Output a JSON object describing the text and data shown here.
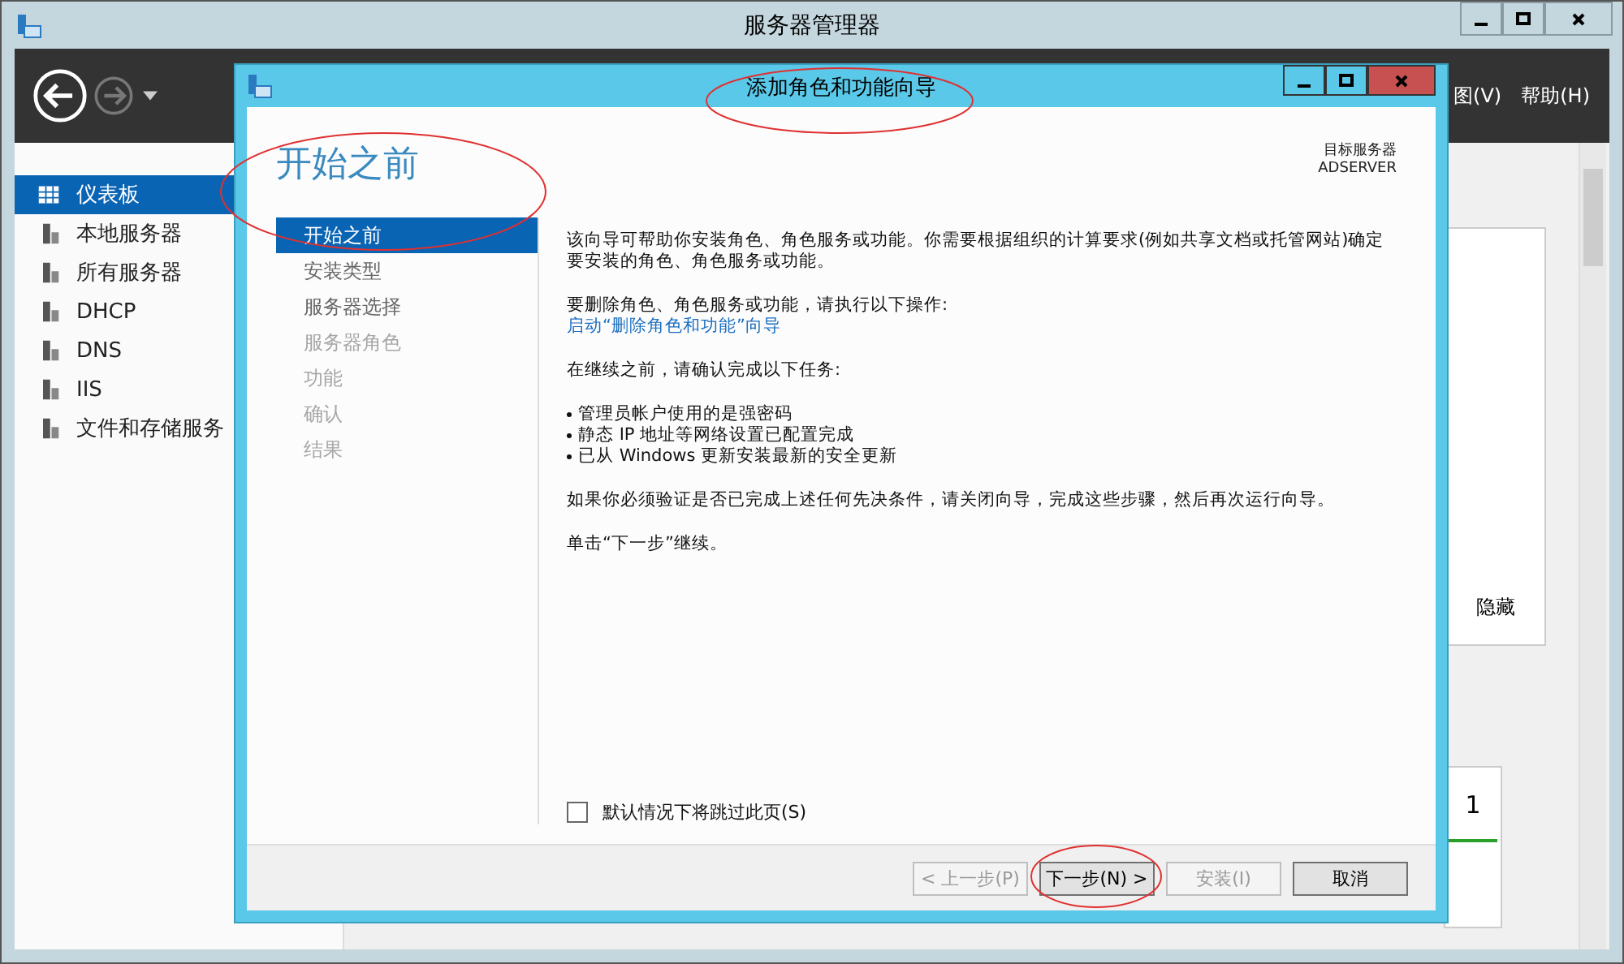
{
  "window": {
    "title": "服务器管理器"
  },
  "menu": [
    "图(V)",
    "帮助(H)"
  ],
  "sidebar": {
    "items": [
      {
        "label": "仪表板",
        "selected": true
      },
      {
        "label": "本地服务器",
        "selected": false
      },
      {
        "label": "所有服务器",
        "selected": false
      },
      {
        "label": "DHCP",
        "selected": false
      },
      {
        "label": "DNS",
        "selected": false
      },
      {
        "label": "IIS",
        "selected": false
      },
      {
        "label": "文件和存储服务",
        "selected": false
      }
    ]
  },
  "right_panel": {
    "hide_label": "隐藏",
    "count": "1"
  },
  "dialog": {
    "title": "添加角色和功能向导",
    "heading": "开始之前",
    "target_label": "目标服务器",
    "target_server": "ADSERVER",
    "steps": [
      {
        "label": "开始之前",
        "selected": true,
        "disabled": false
      },
      {
        "label": "安装类型",
        "selected": false,
        "disabled": false
      },
      {
        "label": "服务器选择",
        "selected": false,
        "disabled": false
      },
      {
        "label": "服务器角色",
        "selected": false,
        "disabled": true
      },
      {
        "label": "功能",
        "selected": false,
        "disabled": true
      },
      {
        "label": "确认",
        "selected": false,
        "disabled": true
      },
      {
        "label": "结果",
        "selected": false,
        "disabled": true
      }
    ],
    "intro": "该向导可帮助你安装角色、角色服务或功能。你需要根据组织的计算要求(例如共享文档或托管网站)确定要安装的角色、角色服务或功能。",
    "remove_prompt": "要删除角色、角色服务或功能，请执行以下操作:",
    "remove_link": "启动“删除角色和功能”向导",
    "before_prompt": "在继续之前，请确认完成以下任务:",
    "tasks": [
      "管理员帐户使用的是强密码",
      "静态 IP 地址等网络设置已配置完成",
      "已从 Windows 更新安装最新的安全更新"
    ],
    "note": "如果你必须验证是否已完成上述任何先决条件，请关闭向导，完成这些步骤，然后再次运行向导。",
    "click_next": "单击“下一步”继续。",
    "skip_checkbox": {
      "label": "默认情况下将跳过此页(S)",
      "checked": false
    },
    "buttons": [
      {
        "label": "< 上一步(P)",
        "disabled": true
      },
      {
        "label": "下一步(N) >",
        "disabled": false
      },
      {
        "label": "安装(I)",
        "disabled": true
      },
      {
        "label": "取消",
        "disabled": false
      }
    ]
  }
}
